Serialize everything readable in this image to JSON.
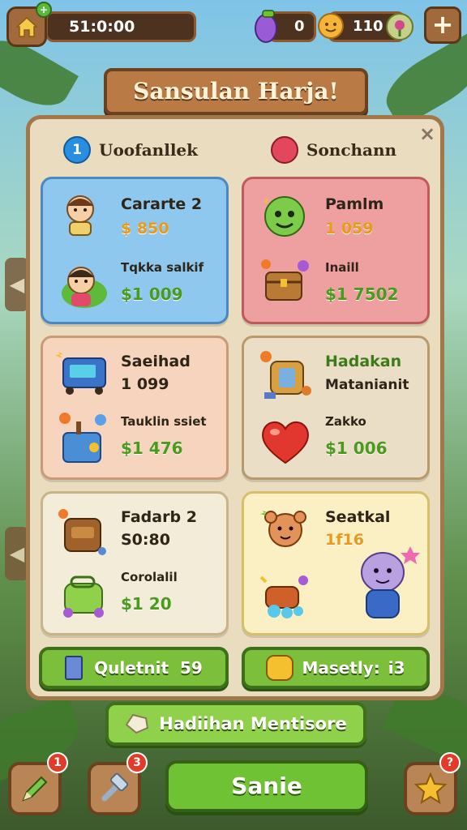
{
  "top_bar": {
    "timer": "51:0:00",
    "gem_count": "0",
    "coin_count": "110",
    "home_badge": "+",
    "plus_label": "+"
  },
  "title": "Sansulan Harja!",
  "close_label": "×",
  "tabs": [
    {
      "label": "Uoofanllek",
      "icon_text": "1",
      "icon": "info-icon"
    },
    {
      "label": "Sonchann",
      "icon_text": "",
      "icon": "apple-icon"
    }
  ],
  "cards": [
    {
      "title": "Cararte 2",
      "price": "$ 850",
      "sub": "Tqkka salkif",
      "cash": "$1 009",
      "icons": [
        "character-girl-icon",
        "character-kid-icon"
      ]
    },
    {
      "title": "Pamlm",
      "price": "1 059",
      "sub": "Inaill",
      "cash": "$1 7502",
      "icons": [
        "green-monster-icon",
        "treasure-chest-icon"
      ]
    },
    {
      "title": "Saeihad",
      "price": "1 099",
      "sub": "Tauklin ssiet",
      "cash": "$1 476",
      "icons": [
        "arcade-machine-icon",
        "gift-machine-icon"
      ]
    },
    {
      "title": "Hadakan",
      "price": "Matanianit",
      "sub": "Zakko",
      "cash": "$1 006",
      "icons": [
        "lantern-icon",
        "heart-icon"
      ]
    },
    {
      "title": "Fadarb 2",
      "price": "S0:80",
      "sub": "Corolalil",
      "cash": "$1 20",
      "icons": [
        "backpack-icon",
        "green-bag-icon"
      ]
    },
    {
      "title": "Seatkal",
      "price": "1f16",
      "sub": "",
      "cash": "",
      "icons": [
        "bear-character-icon",
        "hippo-character-icon"
      ]
    }
  ],
  "stats": [
    {
      "label": "Quletnit",
      "value": "59",
      "icon": "card-icon"
    },
    {
      "label": "Masetly:",
      "value": "i3",
      "icon": "coin-face-icon"
    }
  ],
  "reward_label": "Hadiihan Mentisore",
  "main_button": "Sanie",
  "side_buttons": [
    {
      "icon": "pencil-icon",
      "badge": "1"
    },
    {
      "icon": "hammer-icon",
      "badge": "3"
    },
    {
      "icon": "star-icon",
      "badge": "?"
    }
  ],
  "colors": {
    "panel": "#eadcbf",
    "wood": "#a2774a",
    "green_button": "#7cbf3a",
    "price_gold": "#e89a1a",
    "cash_green": "#4a9a1e"
  }
}
